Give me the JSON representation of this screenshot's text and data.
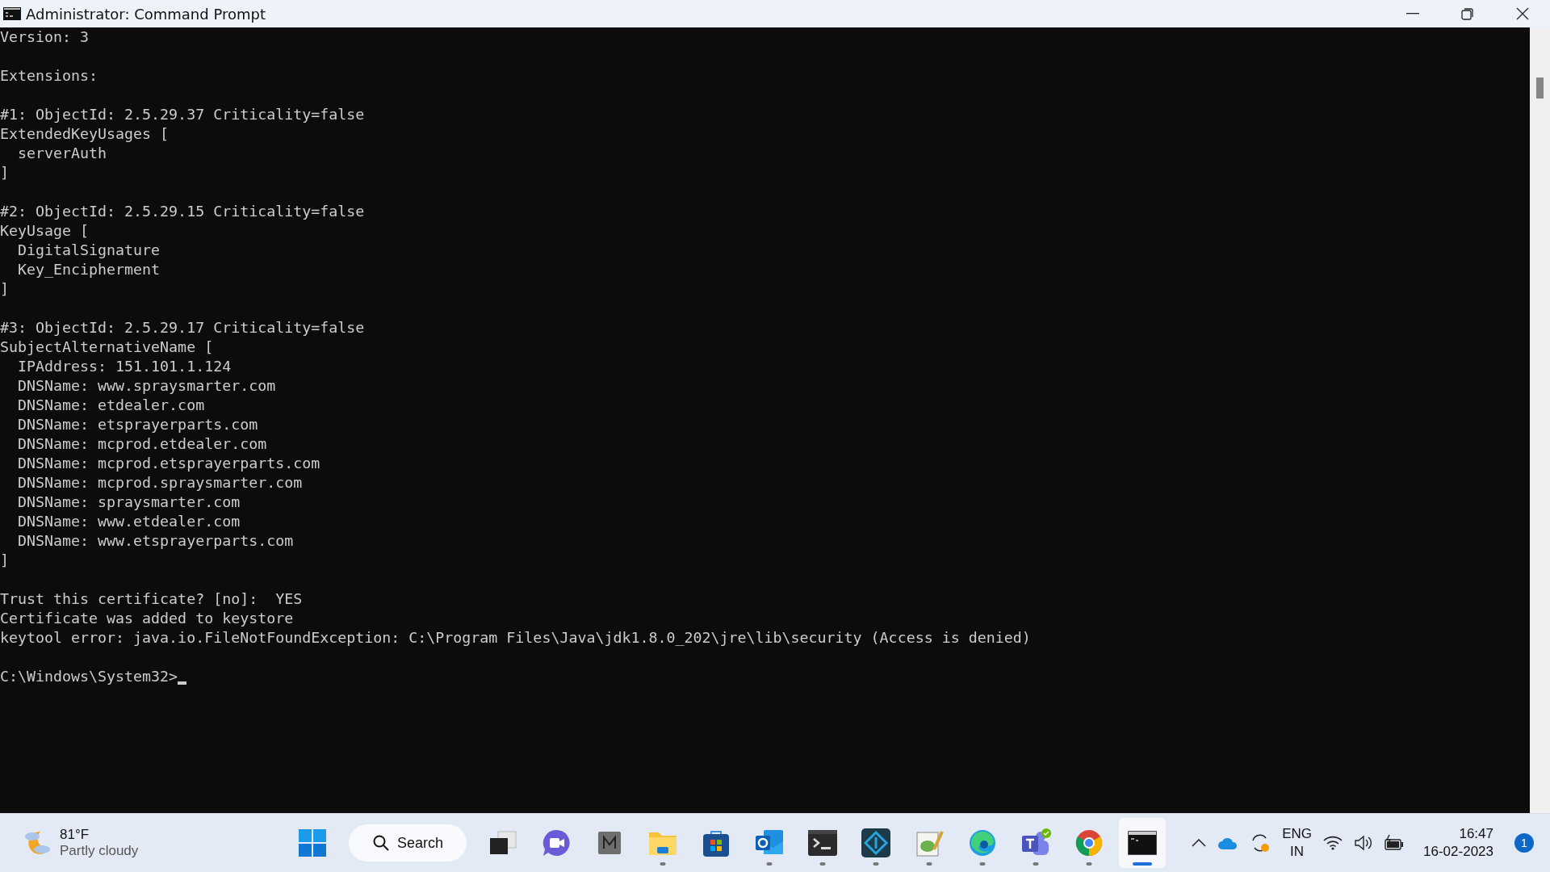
{
  "window": {
    "title": "Administrator: Command Prompt"
  },
  "console": {
    "blocks": [
      [
        "Version: 3"
      ],
      [
        "Extensions:"
      ],
      [
        "#1: ObjectId: 2.5.29.37 Criticality=false",
        "ExtendedKeyUsages [",
        "  serverAuth",
        "]"
      ],
      [
        "#2: ObjectId: 2.5.29.15 Criticality=false",
        "KeyUsage [",
        "  DigitalSignature",
        "  Key_Encipherment",
        "]"
      ],
      [
        "#3: ObjectId: 2.5.29.17 Criticality=false",
        "SubjectAlternativeName [",
        "  IPAddress: 151.101.1.124",
        "  DNSName: www.spraysmarter.com",
        "  DNSName: etdealer.com",
        "  DNSName: etsprayerparts.com",
        "  DNSName: mcprod.etdealer.com",
        "  DNSName: mcprod.etsprayerparts.com",
        "  DNSName: mcprod.spraysmarter.com",
        "  DNSName: spraysmarter.com",
        "  DNSName: www.etdealer.com",
        "  DNSName: www.etsprayerparts.com",
        "]"
      ],
      [
        "Trust this certificate? [no]:  YES",
        "Certificate was added to keystore",
        "keytool error: java.io.FileNotFoundException: C:\\Program Files\\Java\\jdk1.8.0_202\\jre\\lib\\security (Access is denied)"
      ]
    ],
    "prompt": "C:\\Windows\\System32>"
  },
  "taskbar": {
    "weather": {
      "temperature": "81°F",
      "condition": "Partly cloudy"
    },
    "search": {
      "label": "Search"
    },
    "apps": [
      {
        "kind": "taskview",
        "running": false,
        "selected": false
      },
      {
        "kind": "meet",
        "running": false,
        "selected": false
      },
      {
        "kind": "m",
        "running": false,
        "selected": false
      },
      {
        "kind": "files",
        "running": true,
        "selected": false
      },
      {
        "kind": "store",
        "running": false,
        "selected": false
      },
      {
        "kind": "outlook",
        "running": true,
        "selected": false
      },
      {
        "kind": "terminal",
        "running": true,
        "selected": false
      },
      {
        "kind": "sync",
        "running": true,
        "selected": false
      },
      {
        "kind": "notepad",
        "running": true,
        "selected": false
      },
      {
        "kind": "edge",
        "running": true,
        "selected": false
      },
      {
        "kind": "teams",
        "running": true,
        "selected": false
      },
      {
        "kind": "chrome",
        "running": true,
        "selected": false
      },
      {
        "kind": "cmd",
        "running": true,
        "selected": true
      }
    ],
    "tray": {
      "language": "ENG",
      "region": "IN",
      "time": "16:47",
      "date": "16-02-2023",
      "notifications": "1"
    }
  }
}
